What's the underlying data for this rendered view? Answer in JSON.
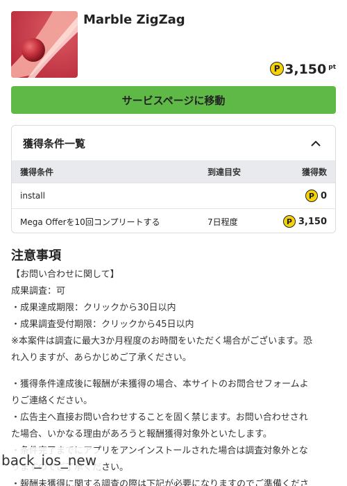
{
  "app": {
    "title": "Marble ZigZag",
    "points_value": "3,150",
    "points_unit": "pt",
    "coin_symbol": "P",
    "icon_name": "marble-zigzag-app-icon"
  },
  "service_button_label": "サービスページに移動",
  "conditions": {
    "title": "獲得条件一覧",
    "columns": [
      "獲得条件",
      "到達目安",
      "獲得数"
    ],
    "rows": [
      {
        "condition": "install",
        "eta": "",
        "points": "0"
      },
      {
        "condition": "Mega Offerを10回コンプリートする",
        "eta": "7日程度",
        "points": "3,150"
      }
    ]
  },
  "notes": {
    "title": "注意事項",
    "lines": [
      "【お問い合わせに関して】",
      "成果調査：可",
      "・成果達成期限：クリックから30日以内",
      "・成果調査受付期限：クリックから45日以内",
      "※本案件は調査に最大3か月程度のお時間をいただく場合がございます。恐",
      "れ入りますが、あらかじめご了承ください。"
    ],
    "lines2": [
      "・獲得条件達成後に報酬が未獲得の場合、本サイトのお問合せフォームよ",
      "りご連絡ください。",
      "・広告主へ直接お問い合わせすることを固く禁じます。お問い合わせされ",
      "た場合、いかなる理由があろうと報酬獲得対象外といたします。",
      "・条件完了までにアプリをアンインストールされた場合は調査対象外とな",
      "りますのでご了承ください。",
      "・報酬未獲得に関する調査の際は下記が必要になりますのでご準備くださ"
    ]
  },
  "overlay_text": "back_ios_new",
  "colors": {
    "accent_green": "#5fb946",
    "coin_yellow": "#f5d20a",
    "table_header_bg": "#e8eaed"
  }
}
